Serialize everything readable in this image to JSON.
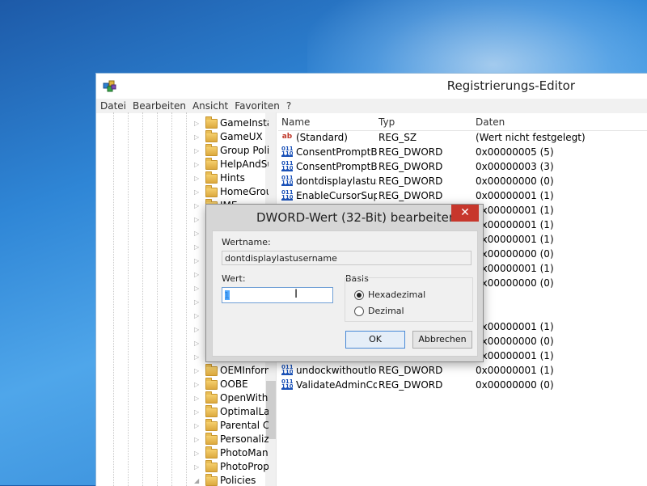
{
  "window": {
    "title": "Registrierungs-Editor",
    "menu": [
      "Datei",
      "Bearbeiten",
      "Ansicht",
      "Favoriten",
      "?"
    ]
  },
  "tree": {
    "items": [
      {
        "label": "GameInstaller",
        "expanded": false
      },
      {
        "label": "GameUX",
        "expanded": false
      },
      {
        "label": "Group Policy",
        "expanded": false
      },
      {
        "label": "HelpAndSupport",
        "expanded": false
      },
      {
        "label": "Hints",
        "expanded": false
      },
      {
        "label": "HomeGroup",
        "expanded": false
      },
      {
        "label": "IME",
        "expanded": false
      },
      {
        "label": "",
        "expanded": false
      },
      {
        "label": "",
        "expanded": false
      },
      {
        "label": "",
        "expanded": false
      },
      {
        "label": "",
        "expanded": false
      },
      {
        "label": "",
        "expanded": false
      },
      {
        "label": "",
        "expanded": false
      },
      {
        "label": "",
        "expanded": false
      },
      {
        "label": "",
        "expanded": false
      },
      {
        "label": "",
        "expanded": false
      },
      {
        "label": "",
        "expanded": false
      },
      {
        "label": "",
        "expanded": false
      },
      {
        "label": "OEMInformation",
        "expanded": false
      },
      {
        "label": "OOBE",
        "expanded": false
      },
      {
        "label": "OpenWith",
        "expanded": false
      },
      {
        "label": "OptimalLayout",
        "expanded": false
      },
      {
        "label": "Parental Controls",
        "expanded": false
      },
      {
        "label": "Personalization",
        "expanded": false
      },
      {
        "label": "PhotoManager",
        "expanded": false
      },
      {
        "label": "PhotoPropertyHandler",
        "expanded": false
      },
      {
        "label": "Policies",
        "expanded": true
      }
    ]
  },
  "list": {
    "headers": {
      "name": "Name",
      "typ": "Typ",
      "daten": "Daten"
    },
    "rows": [
      {
        "name": "(Standard)",
        "typ": "REG_SZ",
        "daten": "(Wert nicht festgelegt)",
        "icon": "string-value-icon",
        "glyph": "ab"
      },
      {
        "name": "ConsentPromptBehaviorAdmin",
        "typ": "REG_DWORD",
        "daten": "0x00000005 (5)",
        "icon": "dword-value-icon",
        "glyph": "011 110"
      },
      {
        "name": "ConsentPromptBehaviorUser",
        "typ": "REG_DWORD",
        "daten": "0x00000003 (3)",
        "icon": "dword-value-icon",
        "glyph": "011 110"
      },
      {
        "name": "dontdisplaylastusername",
        "typ": "REG_DWORD",
        "daten": "0x00000000 (0)",
        "icon": "dword-value-icon",
        "glyph": "011 110"
      },
      {
        "name": "EnableCursorSuppression",
        "typ": "REG_DWORD",
        "daten": "0x00000001 (1)",
        "icon": "dword-value-icon",
        "glyph": "011 110"
      },
      {
        "name": "",
        "typ": "",
        "daten": "0x00000001 (1)",
        "icon": "dword-value-icon",
        "glyph": "011 110"
      },
      {
        "name": "",
        "typ": "",
        "daten": "0x00000001 (1)",
        "icon": "dword-value-icon",
        "glyph": "011 110"
      },
      {
        "name": "",
        "typ": "",
        "daten": "0x00000001 (1)",
        "icon": "dword-value-icon",
        "glyph": "011 110"
      },
      {
        "name": "",
        "typ": "",
        "daten": "0x00000000 (0)",
        "icon": "dword-value-icon",
        "glyph": "011 110"
      },
      {
        "name": "",
        "typ": "",
        "daten": "0x00000001 (1)",
        "icon": "dword-value-icon",
        "glyph": "011 110"
      },
      {
        "name": "",
        "typ": "",
        "daten": "0x00000000 (0)",
        "icon": "dword-value-icon",
        "glyph": "011 110"
      },
      {
        "name": "",
        "typ": "",
        "daten": "",
        "icon": "dword-value-icon",
        "glyph": "011 110"
      },
      {
        "name": "",
        "typ": "",
        "daten": "",
        "icon": "dword-value-icon",
        "glyph": "011 110"
      },
      {
        "name": "",
        "typ": "",
        "daten": "0x00000001 (1)",
        "icon": "dword-value-icon",
        "glyph": "011 110"
      },
      {
        "name": "",
        "typ": "",
        "daten": "0x00000000 (0)",
        "icon": "dword-value-icon",
        "glyph": "011 110"
      },
      {
        "name": "",
        "typ": "",
        "daten": "0x00000001 (1)",
        "icon": "dword-value-icon",
        "glyph": "011 110"
      },
      {
        "name": "undockwithoutlogon",
        "typ": "REG_DWORD",
        "daten": "0x00000001 (1)",
        "icon": "dword-value-icon",
        "glyph": "011 110"
      },
      {
        "name": "ValidateAdminCodeSignatures",
        "typ": "REG_DWORD",
        "daten": "0x00000000 (0)",
        "icon": "dword-value-icon",
        "glyph": "011 110"
      }
    ]
  },
  "dialog": {
    "title": "DWORD-Wert (32-Bit) bearbeiten",
    "close_glyph": "✕",
    "name_label": "Wertname:",
    "name_value": "dontdisplaylastusername",
    "value_label": "Wert:",
    "value": "1",
    "basis_label": "Basis",
    "radio_hex": "Hexadezimal",
    "radio_dec": "Dezimal",
    "selected_basis": "Hexadezimal",
    "ok_label": "OK",
    "cancel_label": "Abbrechen"
  },
  "colors": {
    "close_button": "#c7372c",
    "selection": "#3399ff",
    "dword_icon": "#1b52b8",
    "string_icon": "#c0392b"
  }
}
